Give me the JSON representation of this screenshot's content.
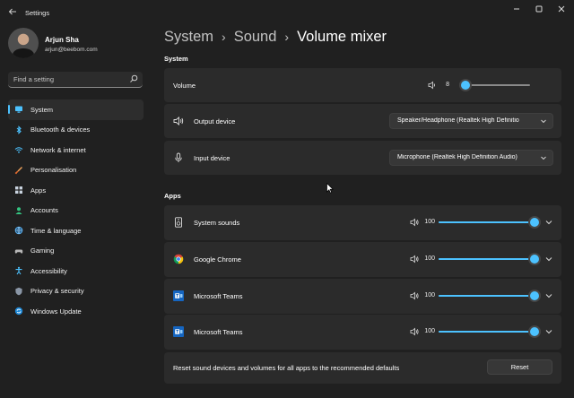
{
  "window": {
    "title": "Settings",
    "icons": {
      "back": "back-arrow-icon",
      "minimize": "minimize-icon",
      "maximize": "maximize-icon",
      "close": "close-icon"
    }
  },
  "profile": {
    "name": "Arjun Sha",
    "email": "arjun@beebom.com"
  },
  "search": {
    "placeholder": "Find a setting",
    "icon": "search-icon"
  },
  "sidebar": {
    "items": [
      {
        "label": "System",
        "icon": "display-icon",
        "selected": true
      },
      {
        "label": "Bluetooth & devices",
        "icon": "bluetooth-icon",
        "selected": false
      },
      {
        "label": "Network & internet",
        "icon": "wifi-icon",
        "selected": false
      },
      {
        "label": "Personalisation",
        "icon": "brush-icon",
        "selected": false
      },
      {
        "label": "Apps",
        "icon": "apps-icon",
        "selected": false
      },
      {
        "label": "Accounts",
        "icon": "person-icon",
        "selected": false
      },
      {
        "label": "Time & language",
        "icon": "globe-clock-icon",
        "selected": false
      },
      {
        "label": "Gaming",
        "icon": "controller-icon",
        "selected": false
      },
      {
        "label": "Accessibility",
        "icon": "accessibility-icon",
        "selected": false
      },
      {
        "label": "Privacy & security",
        "icon": "shield-icon",
        "selected": false
      },
      {
        "label": "Windows Update",
        "icon": "sync-icon",
        "selected": false
      }
    ]
  },
  "breadcrumb": {
    "items": [
      "System",
      "Sound"
    ],
    "current": "Volume mixer"
  },
  "system_section": {
    "header": "System",
    "volume": {
      "label": "Volume",
      "value": "8",
      "level": 0.08
    },
    "output": {
      "label": "Output device",
      "selected": "Speaker/Headphone (Realtek High Definitio"
    },
    "input": {
      "label": "Input device",
      "selected": "Microphone (Realtek High Definition Audio)"
    }
  },
  "apps_section": {
    "header": "Apps",
    "apps": [
      {
        "name": "System sounds",
        "volume": "100",
        "level": 1.0,
        "icon": "speaker-device-icon"
      },
      {
        "name": "Google Chrome",
        "volume": "100",
        "level": 1.0,
        "icon": "chrome-icon"
      },
      {
        "name": "Microsoft Teams",
        "volume": "100",
        "level": 1.0,
        "icon": "teams-icon"
      },
      {
        "name": "Microsoft Teams",
        "volume": "100",
        "level": 1.0,
        "icon": "teams-icon"
      }
    ]
  },
  "reset": {
    "text": "Reset sound devices and volumes for all apps to the recommended defaults",
    "button": "Reset"
  },
  "colors": {
    "background": "#202020",
    "card": "#2b2b2b",
    "accent": "#4cc2ff",
    "track": "#8a8a8a"
  }
}
